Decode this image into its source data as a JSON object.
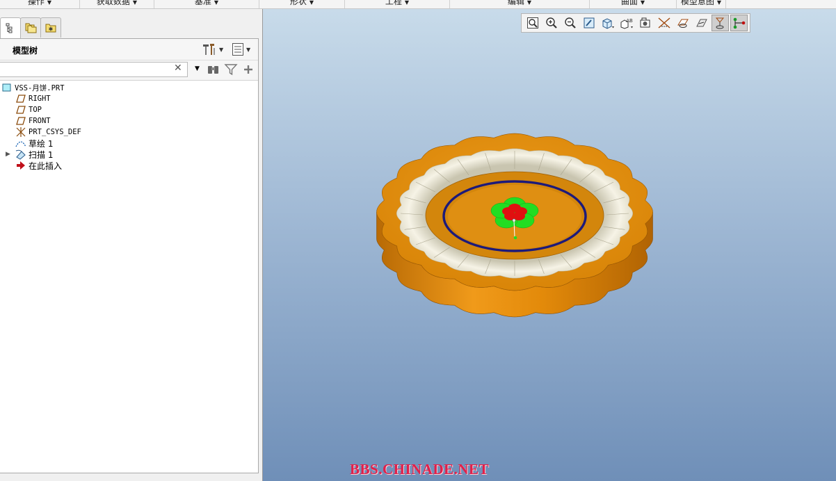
{
  "ribbon": {
    "groups": [
      "操作",
      "获取数据",
      "基准",
      "形状",
      "工程",
      "编辑",
      "曲面",
      "模型意图"
    ]
  },
  "left_panel": {
    "tabs": [
      "model-tree-tab",
      "folder-browser-tab",
      "favorites-tab"
    ],
    "title": "模型树",
    "search": {
      "value": "",
      "placeholder": ""
    },
    "tree": [
      {
        "label": "VSS-月饼.PRT",
        "icon": "part-icon",
        "expandable": false
      },
      {
        "label": "RIGHT",
        "icon": "datum-plane-icon",
        "expandable": false
      },
      {
        "label": "TOP",
        "icon": "datum-plane-icon",
        "expandable": false
      },
      {
        "label": "FRONT",
        "icon": "datum-plane-icon",
        "expandable": false
      },
      {
        "label": "PRT_CSYS_DEF",
        "icon": "coordinate-system-icon",
        "expandable": false
      },
      {
        "label": "草绘 1",
        "icon": "sketch-icon",
        "expandable": false
      },
      {
        "label": "扫描 1",
        "icon": "sweep-icon",
        "expandable": true
      },
      {
        "label": "在此插入",
        "icon": "insert-here-arrow-icon",
        "expandable": false
      }
    ]
  },
  "graphics_toolbar": {
    "buttons": [
      "refit-icon",
      "zoom-in-icon",
      "zoom-out-icon",
      "repaint-icon",
      "saved-orientations-icon",
      "named-views-icon",
      "display-style-icon",
      "plane-display-icon",
      "spin-center-icon",
      "annotation-display-icon",
      "datum-display-icon",
      "point-display-icon"
    ],
    "active": [
      10,
      11
    ]
  },
  "viewport": {
    "watermark": "BBS.CHINADE.NET"
  },
  "colors": {
    "accent_orange": "#e58c0a",
    "cream": "#f2efe2",
    "ring_navy": "#1d1a7a",
    "flower_green": "#22dd22",
    "flower_red": "#e01010",
    "watermark_red": "#e0204a"
  }
}
